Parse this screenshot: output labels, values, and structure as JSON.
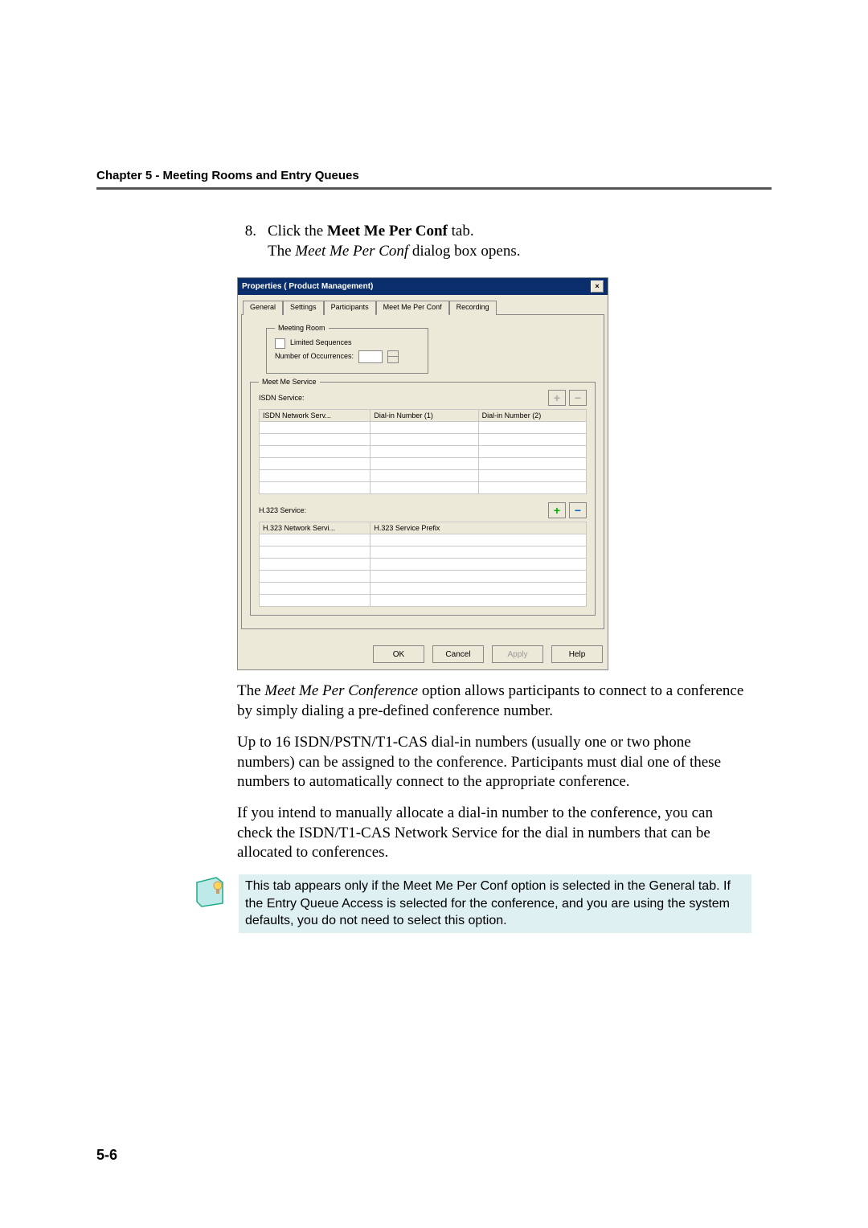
{
  "chapterHeader": "Chapter 5 - Meeting Rooms and Entry Queues",
  "step": {
    "num": "8.",
    "line1_a": "Click the ",
    "line1_b": "Meet Me Per Conf",
    "line1_c": " tab.",
    "line2_a": "The ",
    "line2_b": "Meet Me Per Conf",
    "line2_c": " dialog box opens."
  },
  "dialog": {
    "title": "Properties  (  Product Management)",
    "close": "×",
    "tabs": [
      "General",
      "Settings",
      "Participants",
      "Meet Me Per Conf",
      "Recording"
    ],
    "activeTab": 3,
    "meetingRoom": {
      "groupTitle": "Meeting Room",
      "limitedLabel": "Limited Sequences",
      "occurLabel": "Number of Occurrences:"
    },
    "meetMeService": {
      "groupTitle": "Meet Me Service",
      "isdnLabel": "ISDN Service:",
      "isdnCols": [
        "ISDN Network Serv...",
        "Dial-in Number (1)",
        "Dial-in Number (2)"
      ],
      "h323Label": "H.323 Service:",
      "h323Cols": [
        "H.323 Network Servi...",
        "H.323 Service Prefix"
      ]
    },
    "buttons": {
      "ok": "OK",
      "cancel": "Cancel",
      "apply": "Apply",
      "help": "Help"
    }
  },
  "para1_a": "The ",
  "para1_b": "Meet Me Per Conference",
  "para1_c": " option allows participants to connect to a conference by simply dialing a pre-defined conference number.",
  "para2": "Up to 16 ISDN/PSTN/T1-CAS dial-in numbers (usually one or two phone numbers) can be assigned to the conference. Participants must dial one of these numbers to automatically connect to the appropriate conference.",
  "para3": "If you intend to manually allocate a dial-in number to the conference, you can check the ISDN/T1-CAS Network Service for the dial in numbers that can be allocated to conferences.",
  "note": "This tab appears only if the Meet Me Per Conf option is selected in the General tab. If the Entry Queue Access is selected for the conference, and you are using the system defaults, you do not need to select this option.",
  "pageNumber": "5-6"
}
